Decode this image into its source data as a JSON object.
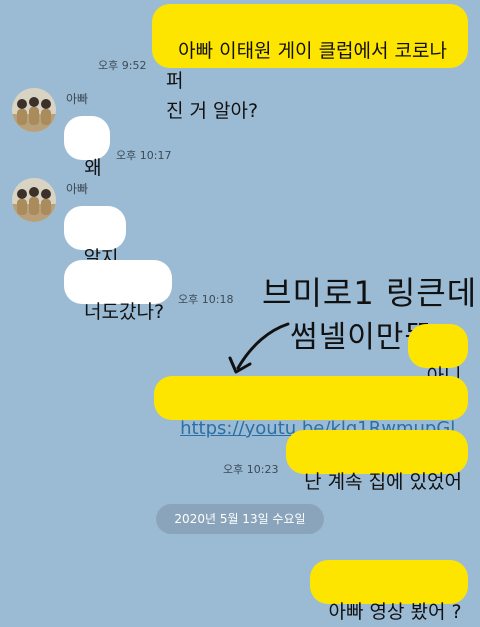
{
  "messages": {
    "m1": "아빠 이태원 게이 클럽에서 코로나 퍼\n진 거 알아?",
    "m1_time": "오후 9:52",
    "sender_name": "아빠",
    "m2": "왜",
    "m2_time": "오후 10:17",
    "m3": "알지",
    "m4": "너도갔나?",
    "m4_time": "오후 10:18",
    "m5": "아니",
    "m6_link": "https://youtu.be/klq1RwmupGl",
    "m7": "난 계속 집에 있었어",
    "m7_time": "오후 10:23",
    "date_divider": "2020년 5월 13일 수요일",
    "m8": "아빠 영상 봤어 ?"
  },
  "annotation": {
    "line1": "브미로1 링큰데",
    "line2": "썸넬이만뜸"
  },
  "colors": {
    "background": "#9bbbd4",
    "my_bubble": "#fee500",
    "their_bubble": "#ffffff",
    "link": "#2a6fa6"
  },
  "icons": {
    "avatar": "profile-photo",
    "annotation_arrow": "hand-drawn-arrow"
  }
}
